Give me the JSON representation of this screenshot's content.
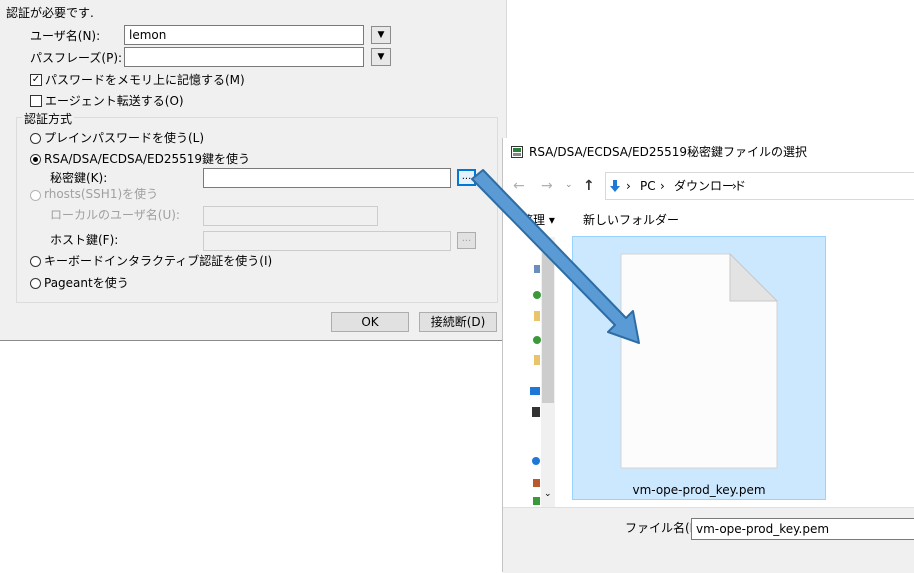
{
  "auth_dialog": {
    "header": "認証が必要です.",
    "username_label": "ユーザ名(N):",
    "username_value": "lemon",
    "passphrase_label": "パスフレーズ(P):",
    "passphrase_value": "",
    "remember_password_label": "パスワードをメモリ上に記憶する(M)",
    "remember_password_checked": true,
    "agent_forward_label": "エージェント転送する(O)",
    "agent_forward_checked": false,
    "group_label": "認証方式",
    "method_plain_label": "プレインパスワードを使う(L)",
    "method_rsa_label": "RSA/DSA/ECDSA/ED25519鍵を使う",
    "private_key_label": "秘密鍵(K):",
    "private_key_value": "",
    "method_rhosts_label": "rhosts(SSH1)を使う",
    "local_user_label": "ローカルのユーザ名(U):",
    "host_key_label": "ホスト鍵(F):",
    "method_keyboard_label": "キーボードインタラクティブ認証を使う(I)",
    "method_pageant_label": "Pageantを使う",
    "ellipsis_label": "...",
    "ok_label": "OK",
    "disconnect_label": "接続断(D)",
    "selected_method": "rsa"
  },
  "file_dialog": {
    "title": "RSA/DSA/ECDSA/ED25519秘密鍵ファイルの選択",
    "address_path": [
      "PC",
      "ダウンロード"
    ],
    "organize_label": "整理 ▾",
    "new_folder_label": "新しいフォルダー",
    "file_name": "vm-ope-prod_key.pem",
    "filename_label": "ファイル名(N):",
    "filename_value": "vm-ope-prod_key.pem"
  },
  "colors": {
    "dialog_bg": "#f0f0f0",
    "selection_bg": "#cce8ff",
    "selection_border": "#99d1ff",
    "arrow_fill": "#5b9bd5",
    "arrow_stroke": "#2e6da4",
    "nav_arrow_blue": "#1e78d7"
  },
  "icons": {
    "dropdown": "triangle-down-icon",
    "back": "arrow-left-icon",
    "forward": "arrow-right-icon",
    "up": "arrow-up-icon",
    "downloads": "download-arrow-icon",
    "file": "document-icon"
  }
}
